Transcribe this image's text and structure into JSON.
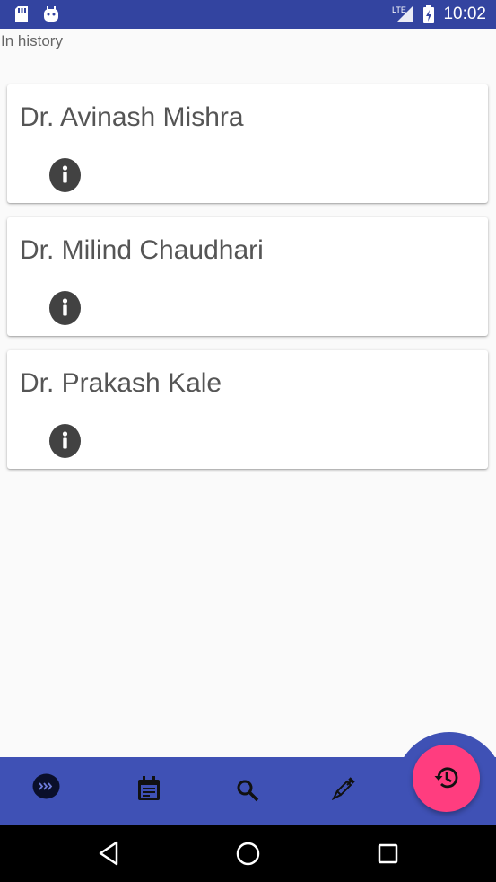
{
  "status_bar": {
    "time": "10:02",
    "network_label": "LTE",
    "icons": [
      "sd-card-icon",
      "android-icon",
      "signal-icon",
      "battery-charging-icon"
    ]
  },
  "screen": {
    "history_label": "In history"
  },
  "doctors": [
    {
      "name": "Dr. Avinash Mishra"
    },
    {
      "name": "Dr. Milind Chaudhari"
    },
    {
      "name": "Dr. Prakash Kale"
    }
  ],
  "bottom_nav": {
    "items": [
      "forward-icon",
      "calendar-icon",
      "search-icon",
      "syringe-icon"
    ],
    "fab_icon": "history-icon",
    "colors": {
      "bar": "#3f51b5",
      "fab": "#ff3d7f"
    }
  },
  "system_nav": [
    "back-icon",
    "home-icon",
    "recents-icon"
  ]
}
